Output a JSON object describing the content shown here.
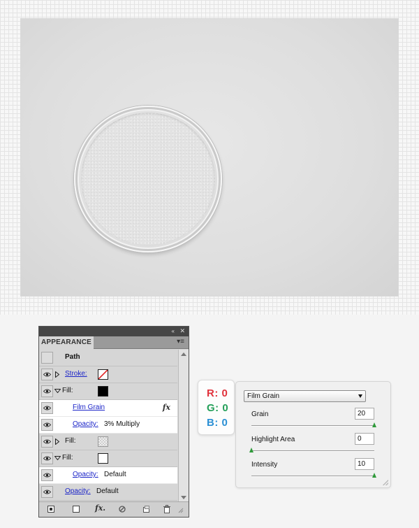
{
  "canvas": {
    "grid_color": "#e4e4e4",
    "artboard_color": "#e2e2e2"
  },
  "appearance_panel": {
    "tab_label": "APPEARANCE",
    "collapse_icon": "«",
    "close_icon": "✕",
    "menu_icon": "▾≡",
    "rows": [
      {
        "label": "Path",
        "type": "header"
      },
      {
        "label": "Stroke:",
        "type": "stroke",
        "swatch": "none"
      },
      {
        "label": "Fill:",
        "type": "fill",
        "swatch": "#000000"
      },
      {
        "label": "Film Grain",
        "type": "effect",
        "fx": "fx"
      },
      {
        "label": "Opacity:",
        "value": "3% Multiply",
        "type": "opacity"
      },
      {
        "label": "Fill:",
        "type": "fill",
        "swatch": "pattern"
      },
      {
        "label": "Fill:",
        "type": "fill",
        "swatch": "#ffffff"
      },
      {
        "label": "Opacity:",
        "value": "Default",
        "type": "opacity"
      },
      {
        "label": "Opacity:",
        "value": "Default",
        "type": "opacity"
      }
    ],
    "footer": {
      "fx_label": "fx."
    }
  },
  "rgb_badge": {
    "r": "R: 0",
    "g": "G: 0",
    "b": "B: 0",
    "colors": {
      "r": "#e0313b",
      "g": "#25a05a",
      "b": "#2a8fd4"
    }
  },
  "film_grain": {
    "selected_filter": "Film Grain",
    "params": [
      {
        "label": "Grain",
        "value": "20",
        "level": 1.0
      },
      {
        "label": "Highlight Area",
        "value": "0",
        "level": 0.0
      },
      {
        "label": "Intensity",
        "value": "10",
        "level": 1.0
      }
    ]
  }
}
